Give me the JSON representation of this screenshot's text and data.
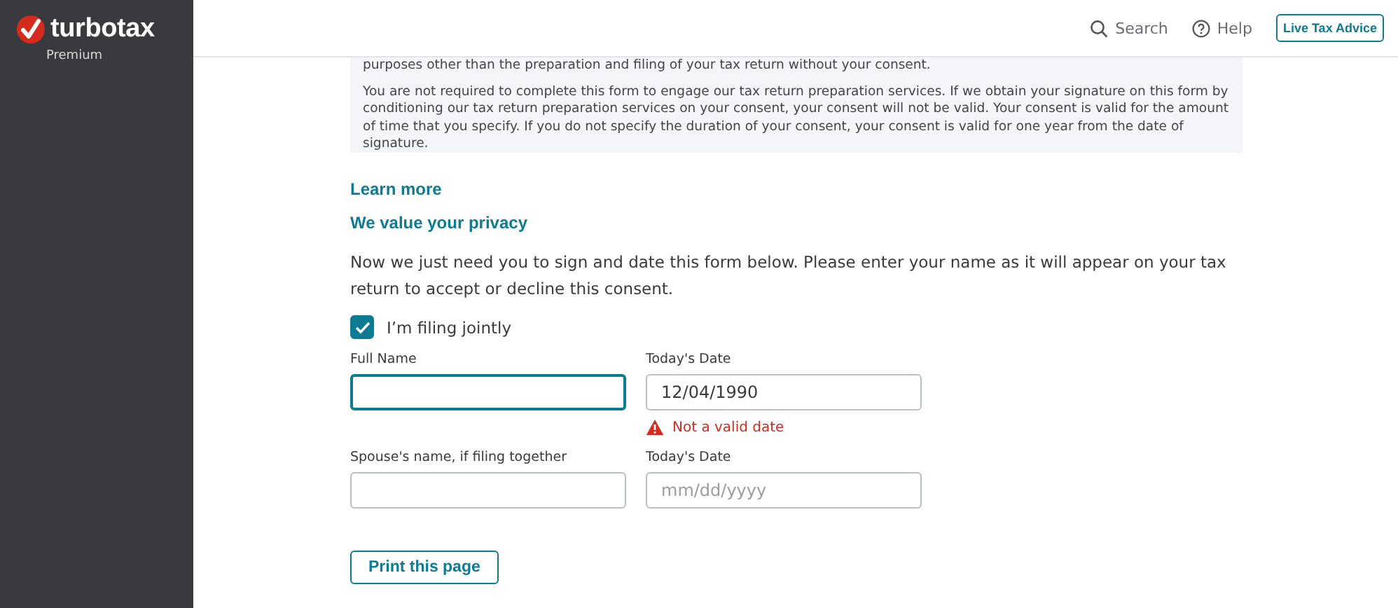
{
  "sidebar": {
    "brand": "turbotax",
    "edition": "Premium"
  },
  "header": {
    "search": "Search",
    "help": "Help",
    "advice_button": "Live Tax Advice"
  },
  "consent_text": [
    "purposes other than the preparation and filing of your tax return without your consent.",
    "You are not required to complete this form to engage our tax return preparation services. If we obtain your signature on this form by conditioning our tax return preparation services on your consent, your consent will not be valid. Your consent is valid for the amount of time that you specify. If you do not specify the duration of your consent, your consent is valid for one year from the date of signature."
  ],
  "links": [
    "Learn more",
    "We value your privacy"
  ],
  "instructions": "Now we just need you to sign and date this form below. Please enter your name as it will appear on your tax return to accept or decline this consent.",
  "joint_checkbox": {
    "label": "I’m filing jointly",
    "checked": true
  },
  "field_rows": [
    {
      "fields": [
        {
          "label": "Full Name",
          "focused": true
        },
        {
          "label": "Today's Date",
          "value": "12/04/1990",
          "focused": false,
          "error": "Not a valid date"
        }
      ]
    },
    {
      "fields": [
        {
          "label": "Spouse's name, if filing together",
          "focused": false
        },
        {
          "label": "Today's Date",
          "placeholder": "mm/dd/yyyy",
          "focused": false
        }
      ]
    }
  ],
  "print_button": "Print this page"
}
